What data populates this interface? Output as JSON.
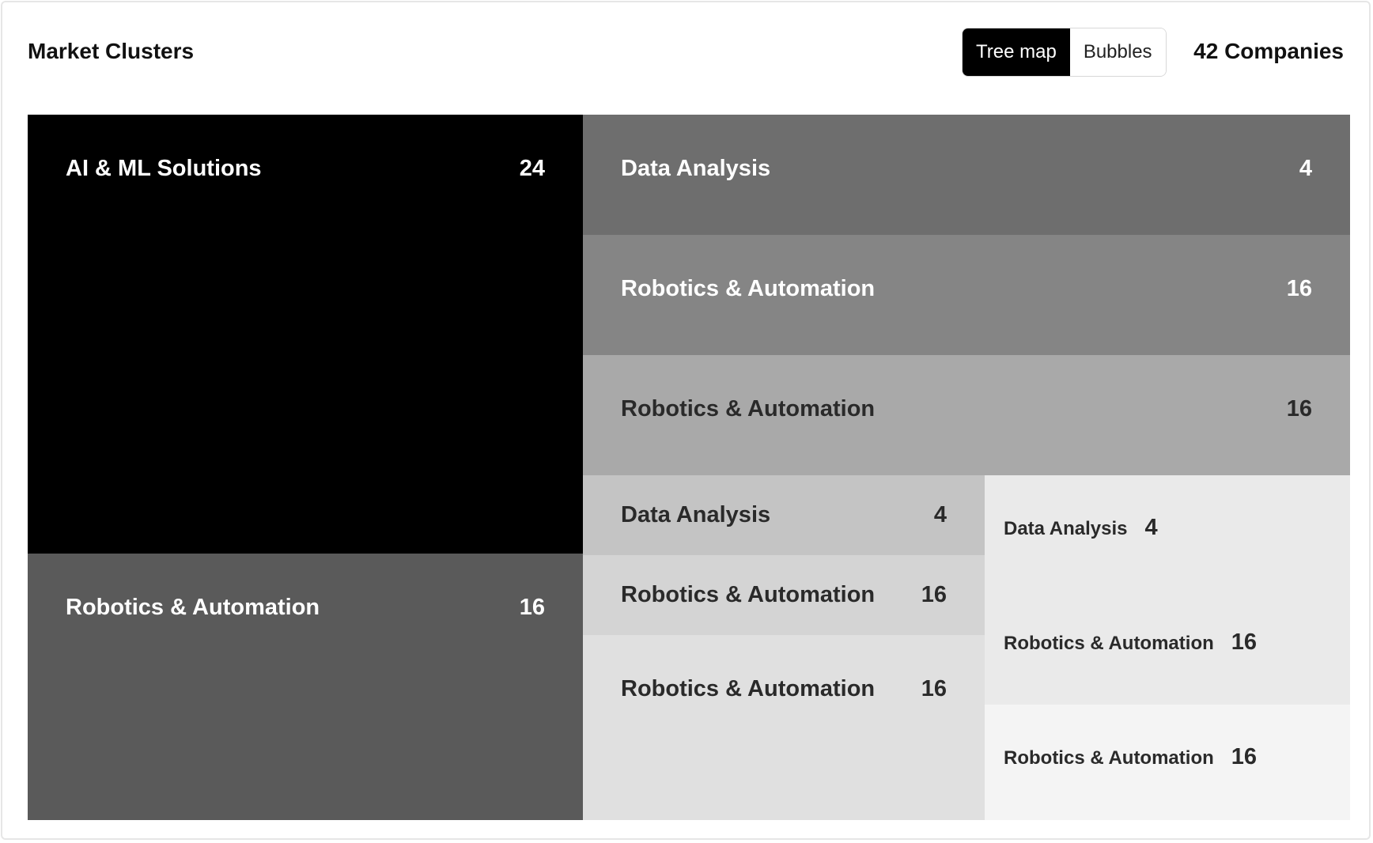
{
  "header": {
    "title": "Market Clusters",
    "toggle": {
      "treemap_label": "Tree map",
      "bubbles_label": "Bubbles",
      "active": "Tree map"
    },
    "companies_count": "42 Companies"
  },
  "treemap": {
    "tiles": [
      {
        "label": "AI & ML Solutions",
        "value": "24",
        "color": "#000000"
      },
      {
        "label": "Robotics & Automation",
        "value": "16",
        "color": "#5a5a5a"
      },
      {
        "label": "Data Analysis",
        "value": "4",
        "color": "#6e6e6e"
      },
      {
        "label": "Robotics & Automation",
        "value": "16",
        "color": "#858585"
      },
      {
        "label": "Robotics & Automation",
        "value": "16",
        "color": "#a9a9a9"
      },
      {
        "label": "Data Analysis",
        "value": "4",
        "color": "#c4c4c4"
      },
      {
        "label": "Robotics & Automation",
        "value": "16",
        "color": "#d4d4d4"
      },
      {
        "label": "Robotics & Automation",
        "value": "16",
        "color": "#e0e0e0"
      },
      {
        "label": "Data Analysis",
        "value": "4",
        "color": "#eaeaea"
      },
      {
        "label": "Robotics & Automation",
        "value": "16",
        "color": "#eaeaea"
      },
      {
        "label": "Robotics & Automation",
        "value": "16",
        "color": "#f4f4f4"
      }
    ]
  }
}
